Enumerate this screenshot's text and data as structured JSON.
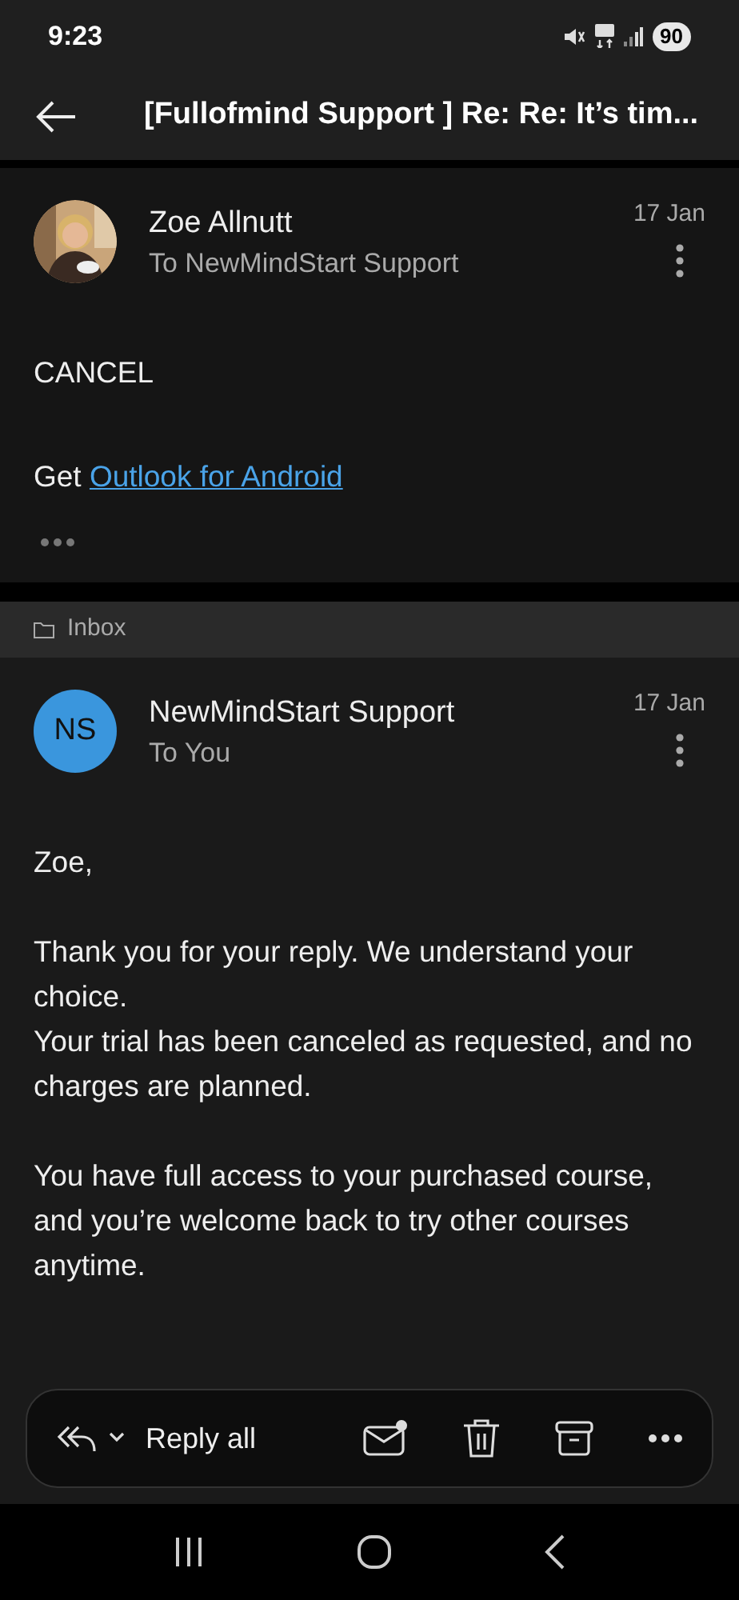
{
  "status_bar": {
    "time": "9:23",
    "battery": "90"
  },
  "app_bar": {
    "title": "[Fullofmind Support ] Re: Re: It’s tim..."
  },
  "messages": [
    {
      "sender": "Zoe Allnutt",
      "recipient": "To NewMindStart Support",
      "date": "17 Jan",
      "avatar": {
        "kind": "picture"
      },
      "body": [
        {
          "kind": "text",
          "text": "CANCEL"
        },
        {
          "kind": "link_line",
          "text": "Get ",
          "link": "Outlook for Android"
        }
      ],
      "collapsed_quote": true
    },
    {
      "folder": "Inbox",
      "sender": "NewMindStart Support",
      "recipient": "To You",
      "date": "17 Jan",
      "avatar": {
        "kind": "initials",
        "initials": "NS",
        "color": "#3a96dd"
      },
      "body": [
        {
          "kind": "text",
          "text": "Zoe,"
        },
        {
          "kind": "text",
          "text": "Thank you for your reply. We understand your choice.\nYour trial has been canceled as requested, and no charges are planned."
        },
        {
          "kind": "text",
          "text": "You have full access to your purchased course, and you’re welcome back to try other courses anytime."
        }
      ]
    }
  ],
  "toolbar": {
    "reply_label": "Reply all"
  }
}
